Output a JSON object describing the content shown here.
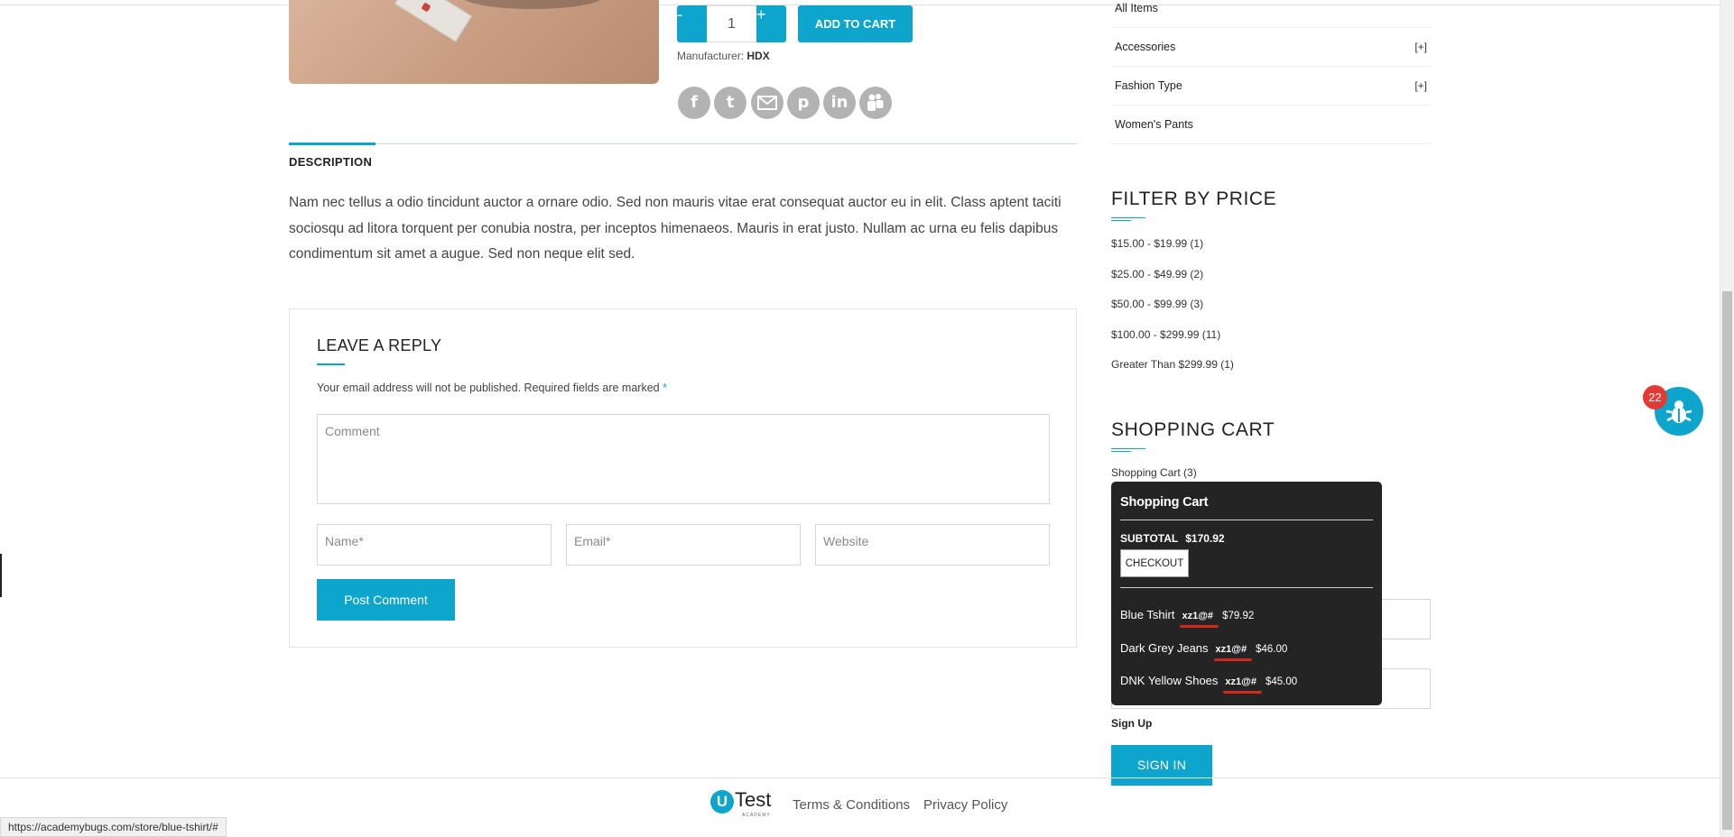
{
  "product": {
    "qty_minus": "-",
    "qty_value": "1",
    "qty_plus": "+",
    "add_to_cart": "ADD TO CART",
    "manufacturer_label": "Manufacturer:",
    "manufacturer_value": "HDX",
    "share_icons": [
      "facebook-icon",
      "twitter-icon",
      "email-icon",
      "pinterest-icon",
      "linkedin-icon",
      "myspace-icon"
    ]
  },
  "tabs": {
    "description_label": "DESCRIPTION"
  },
  "description": "Nam nec tellus a odio tincidunt auctor a ornare odio. Sed non mauris vitae erat consequat auctor eu in elit. Class aptent taciti sociosqu ad litora torquent per conubia nostra, per inceptos himenaeos. Mauris in erat justo. Nullam ac urna eu felis dapibus condimentum sit amet a augue. Sed non neque elit sed.",
  "reply": {
    "title": "LEAVE A REPLY",
    "note": "Your email address will not be published. Required fields are marked",
    "required_mark": "*",
    "comment_placeholder": "Comment",
    "name_placeholder": "Name*",
    "email_placeholder": "Email*",
    "website_placeholder": "Website",
    "post_button": "Post Comment"
  },
  "sidebar": {
    "categories": [
      {
        "label": "All Items",
        "expander": ""
      },
      {
        "label": "Accessories",
        "expander": "[+]"
      },
      {
        "label": "Fashion Type",
        "expander": "[+]"
      },
      {
        "label": "Women's Pants",
        "expander": ""
      }
    ],
    "filter_title": "FILTER BY PRICE",
    "price_ranges": [
      "$15.00 - $19.99 (1)",
      "$25.00 - $49.99 (2)",
      "$50.00 - $99.99 (3)",
      "$100.00 - $299.99 (11)",
      "Greater Than $299.99 (1)"
    ],
    "cart_title": "SHOPPING CART",
    "cart_link": "Shopping Cart (3)",
    "sign_up": "Sign Up",
    "sign_in": "SIGN IN"
  },
  "cart_popup": {
    "title": "Shopping Cart",
    "subtotal_label": "SUBTOTAL",
    "subtotal_value": "$170.92",
    "checkout": "CHECKOUT",
    "items": [
      {
        "name": "Blue Tshirt",
        "code": "xz1@#",
        "price": "$79.92"
      },
      {
        "name": "Dark Grey Jeans",
        "code": "xz1@#",
        "price": "$46.00"
      },
      {
        "name": "DNK Yellow Shoes",
        "code": "xz1@#",
        "price": "$45.00"
      }
    ]
  },
  "bug_widget": {
    "badge": "22",
    "icon": "bug-icon"
  },
  "footer": {
    "logo_text": "Test",
    "logo_letter": "U",
    "logo_sub": "ACADEMY",
    "terms": "Terms & Conditions",
    "privacy": "Privacy Policy"
  },
  "status_url": "https://academybugs.com/store/blue-tshirt/#",
  "colors": {
    "accent": "#0ea5cc",
    "popup_bg": "#242424",
    "badge": "#e53935",
    "underline": "#d4271d"
  }
}
